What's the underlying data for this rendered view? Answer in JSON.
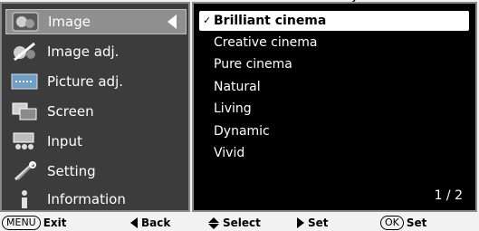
{
  "menu": {
    "items": [
      {
        "label": "Image",
        "icon": "image-icon",
        "selected": true
      },
      {
        "label": "Image adj.",
        "icon": "image-adj-icon",
        "selected": false
      },
      {
        "label": "Picture adj.",
        "icon": "picture-adj-icon",
        "selected": false
      },
      {
        "label": "Screen",
        "icon": "screen-icon",
        "selected": false
      },
      {
        "label": "Input",
        "icon": "input-icon",
        "selected": false
      },
      {
        "label": "Setting",
        "icon": "setting-icon",
        "selected": false
      },
      {
        "label": "Information",
        "icon": "information-icon",
        "selected": false
      }
    ]
  },
  "options": {
    "checkmark": "✓",
    "items": [
      {
        "label": "Brilliant cinema",
        "selected": true
      },
      {
        "label": "Creative cinema",
        "selected": false
      },
      {
        "label": "Pure cinema",
        "selected": false
      },
      {
        "label": "Natural",
        "selected": false
      },
      {
        "label": "Living",
        "selected": false
      },
      {
        "label": "Dynamic",
        "selected": false
      },
      {
        "label": "Vivid",
        "selected": false
      }
    ],
    "page": "1 / 2"
  },
  "footer": {
    "menu_key": "MENU",
    "exit": "Exit",
    "back": "Back",
    "select": "Select",
    "set": "Set",
    "ok_key": "OK",
    "ok_set": "Set"
  },
  "colors": {
    "left_panel_bg": "#3c3c3c",
    "right_panel_bg": "#000000",
    "selected_item_bg": "#8f8f8f",
    "selected_option_bg": "#ffffff",
    "text_light": "#ffffff",
    "text_dark": "#000000"
  }
}
